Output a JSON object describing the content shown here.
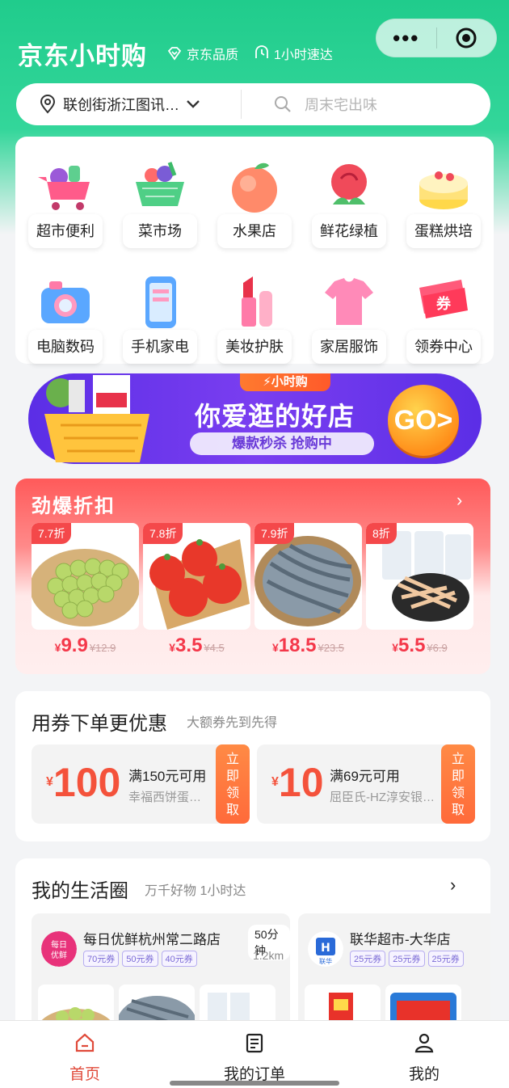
{
  "header": {
    "brand": "京东小时购",
    "tag_quality": "京东品质",
    "tag_fast": "1小时速达",
    "quality_icon": "diamond-icon",
    "fast_icon": "clock-hand-icon"
  },
  "location_bar": {
    "location": "联创街浙江图讯…",
    "search_placeholder": "周末宅出味"
  },
  "categories": [
    {
      "label": "超市便利",
      "icon": "shopping-cart-icon"
    },
    {
      "label": "菜市场",
      "icon": "vegetable-basket-icon"
    },
    {
      "label": "水果店",
      "icon": "peach-icon"
    },
    {
      "label": "鲜花绿植",
      "icon": "rose-icon"
    },
    {
      "label": "蛋糕烘培",
      "icon": "cake-icon"
    },
    {
      "label": "电脑数码",
      "icon": "camera-icon"
    },
    {
      "label": "手机家电",
      "icon": "phone-icon"
    },
    {
      "label": "美妆护肤",
      "icon": "lipstick-icon"
    },
    {
      "label": "家居服饰",
      "icon": "shirt-icon"
    },
    {
      "label": "领券中心",
      "icon": "coupon-ticket-icon"
    }
  ],
  "banner": {
    "ribbon": "⚡小时购",
    "main": "你爱逛的好店",
    "sub": "爆款秒杀 抢购中",
    "go": "GO>"
  },
  "deals": {
    "title": "劲爆折扣",
    "arrow": "›",
    "items": [
      {
        "badge": "7.7折",
        "yen": "¥",
        "price": "9.9",
        "old": "¥12.9",
        "image": "grapes"
      },
      {
        "badge": "7.8折",
        "yen": "¥",
        "price": "3.5",
        "old": "¥4.5",
        "image": "tomatoes"
      },
      {
        "badge": "7.9折",
        "yen": "¥",
        "price": "18.5",
        "old": "¥23.5",
        "image": "shrimp"
      },
      {
        "badge": "8折",
        "yen": "¥",
        "price": "5.5",
        "old": "¥6.9",
        "image": "dried-squid"
      }
    ]
  },
  "coupons": {
    "title": "用券下单更优惠",
    "subtitle": "大额券先到先得",
    "items": [
      {
        "yen": "¥",
        "amount": "100",
        "condition": "满150元可用",
        "store": "幸福西饼蛋…",
        "claim": "立即领取"
      },
      {
        "yen": "¥",
        "amount": "10",
        "condition": "满69元可用",
        "store": "屈臣氏-HZ淳安银…",
        "claim": "立即领取"
      }
    ]
  },
  "life": {
    "title": "我的生活圈",
    "subtitle": "万千好物 1小时达",
    "arrow": "›",
    "stores": [
      {
        "name": "每日优鲜杭州常二路店",
        "logo_text": "每日优鲜",
        "chips": [
          "70元券",
          "50元券",
          "40元券"
        ],
        "eta": "50分钟",
        "distance": "1.2km"
      },
      {
        "name": "联华超市-大华店",
        "logo_text": "联华",
        "chips": [
          "25元券",
          "25元券",
          "25元券"
        ],
        "eta": "",
        "distance": ""
      }
    ]
  },
  "tabbar": {
    "tabs": [
      {
        "label": "首页",
        "icon": "home-icon",
        "active": true
      },
      {
        "label": "我的订单",
        "icon": "order-list-icon",
        "active": false
      },
      {
        "label": "我的",
        "icon": "user-icon",
        "active": false
      }
    ]
  },
  "colors": {
    "brand_green": "#20cc8c",
    "deal_red": "#f4384a",
    "coupon_orange": "#ff6a3a",
    "banner_purple": "#5b2ee6",
    "active_tab": "#e04a3a"
  }
}
